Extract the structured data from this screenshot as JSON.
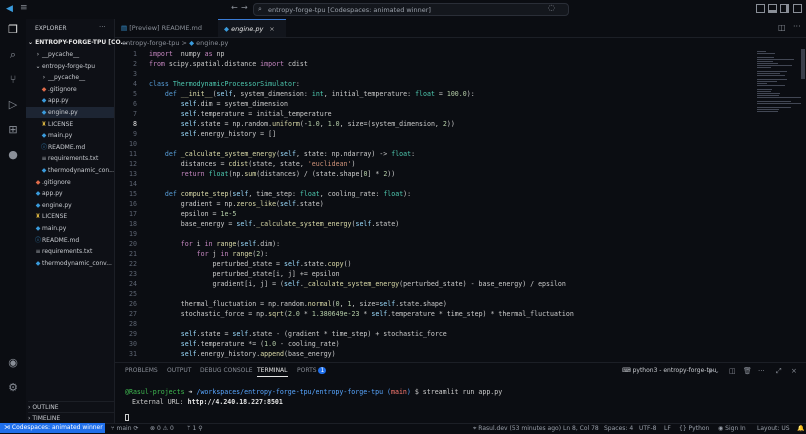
{
  "titlebar": {
    "back": "←",
    "forward": "→",
    "search_text": "entropy-forge-tpu [Codespaces: animated winner]"
  },
  "sidebar": {
    "header": "EXPLORER",
    "root": "ENTROPY-FORGE-TPU [CO...",
    "items": [
      {
        "label": "__pycache__",
        "depth": 1,
        "kind": "folder",
        "open": false
      },
      {
        "label": "entropy-forge-tpu",
        "depth": 1,
        "kind": "folder",
        "open": true
      },
      {
        "label": "__pycache__",
        "depth": 2,
        "kind": "folder",
        "open": false
      },
      {
        "label": ".gitignore",
        "depth": 2,
        "kind": "git"
      },
      {
        "label": "app.py",
        "depth": 2,
        "kind": "py"
      },
      {
        "label": "engine.py",
        "depth": 2,
        "kind": "py",
        "selected": true
      },
      {
        "label": "LICENSE",
        "depth": 2,
        "kind": "license"
      },
      {
        "label": "main.py",
        "depth": 2,
        "kind": "py"
      },
      {
        "label": "README.md",
        "depth": 2,
        "kind": "md"
      },
      {
        "label": "requirements.txt",
        "depth": 2,
        "kind": "txt"
      },
      {
        "label": "thermodynamic_con...",
        "depth": 2,
        "kind": "py"
      },
      {
        "label": ".gitignore",
        "depth": 1,
        "kind": "git"
      },
      {
        "label": "app.py",
        "depth": 1,
        "kind": "py"
      },
      {
        "label": "engine.py",
        "depth": 1,
        "kind": "py"
      },
      {
        "label": "LICENSE",
        "depth": 1,
        "kind": "license"
      },
      {
        "label": "main.py",
        "depth": 1,
        "kind": "py"
      },
      {
        "label": "README.md",
        "depth": 1,
        "kind": "md"
      },
      {
        "label": "requirements.txt",
        "depth": 1,
        "kind": "txt"
      },
      {
        "label": "thermodynamic_conv...",
        "depth": 1,
        "kind": "py"
      }
    ],
    "outline": "OUTLINE",
    "timeline": "TIMELINE"
  },
  "tabs": [
    {
      "label": "[Preview] README.md",
      "active": false
    },
    {
      "label": "engine.py",
      "active": true
    }
  ],
  "breadcrumb": {
    "folder": "entropy-forge-tpu",
    "sep": ">",
    "file": "engine.py"
  },
  "code_lines": [
    {
      "n": "1",
      "segs": [
        [
          "kw",
          "import"
        ],
        [
          "",
          "  numpy "
        ],
        [
          "kw",
          "as"
        ],
        [
          "",
          " np"
        ]
      ]
    },
    {
      "n": "2",
      "segs": [
        [
          "kw",
          "from"
        ],
        [
          "",
          " scipy.spatial.distance "
        ],
        [
          "kw",
          "import"
        ],
        [
          "",
          " cdist"
        ]
      ]
    },
    {
      "n": "3",
      "segs": []
    },
    {
      "n": "4",
      "segs": [
        [
          "def",
          "class"
        ],
        [
          "",
          " "
        ],
        [
          "cls",
          "ThermodynamicProcessorSimulator"
        ],
        [
          "",
          ":"
        ]
      ]
    },
    {
      "n": "5",
      "segs": [
        [
          "",
          "    "
        ],
        [
          "def",
          "def"
        ],
        [
          "",
          " "
        ],
        [
          "fn",
          "__init__"
        ],
        [
          "",
          "("
        ],
        [
          "self",
          "self"
        ],
        [
          "",
          ", system_dimension: "
        ],
        [
          "cls",
          "int"
        ],
        [
          "",
          ", initial_temperature: "
        ],
        [
          "cls",
          "float"
        ],
        [
          "",
          " = "
        ],
        [
          "num",
          "100.0"
        ],
        [
          "",
          "):"
        ]
      ]
    },
    {
      "n": "6",
      "segs": [
        [
          "",
          "        "
        ],
        [
          "self",
          "self"
        ],
        [
          "",
          ".dim = system_dimension"
        ]
      ]
    },
    {
      "n": "7",
      "segs": [
        [
          "",
          "        "
        ],
        [
          "self",
          "self"
        ],
        [
          "",
          ".temperature = initial_temperature"
        ]
      ]
    },
    {
      "n": "8",
      "segs": [
        [
          "",
          "        "
        ],
        [
          "self",
          "self"
        ],
        [
          "",
          ".state = np.random."
        ],
        [
          "fn",
          "uniform"
        ],
        [
          "",
          "(-"
        ],
        [
          "num",
          "1.0"
        ],
        [
          "",
          ", "
        ],
        [
          "num",
          "1.0"
        ],
        [
          "",
          ", size=(system_dimension, "
        ],
        [
          "num",
          "2"
        ],
        [
          "",
          "))"
        ]
      ],
      "cur": true
    },
    {
      "n": "9",
      "segs": [
        [
          "",
          "        "
        ],
        [
          "self",
          "self"
        ],
        [
          "",
          ".energy_history = []"
        ]
      ]
    },
    {
      "n": "10",
      "segs": []
    },
    {
      "n": "11",
      "segs": [
        [
          "",
          "    "
        ],
        [
          "def",
          "def"
        ],
        [
          "",
          " "
        ],
        [
          "fn",
          "_calculate_system_energy"
        ],
        [
          "",
          "("
        ],
        [
          "self",
          "self"
        ],
        [
          "",
          ", state: np.ndarray) -> "
        ],
        [
          "cls",
          "float"
        ],
        [
          "",
          ":"
        ]
      ]
    },
    {
      "n": "12",
      "segs": [
        [
          "",
          "        distances = "
        ],
        [
          "fn",
          "cdist"
        ],
        [
          "",
          "(state, state, "
        ],
        [
          "str",
          "'euclidean'"
        ],
        [
          "",
          ")"
        ]
      ]
    },
    {
      "n": "13",
      "segs": [
        [
          "",
          "        "
        ],
        [
          "kw",
          "return"
        ],
        [
          "",
          " "
        ],
        [
          "cls",
          "float"
        ],
        [
          "",
          "(np."
        ],
        [
          "fn",
          "sum"
        ],
        [
          "",
          "(distances) / (state.shape["
        ],
        [
          "num",
          "0"
        ],
        [
          "",
          "] * "
        ],
        [
          "num",
          "2"
        ],
        [
          "",
          "))"
        ]
      ]
    },
    {
      "n": "14",
      "segs": []
    },
    {
      "n": "15",
      "segs": [
        [
          "",
          "    "
        ],
        [
          "def",
          "def"
        ],
        [
          "",
          " "
        ],
        [
          "fn",
          "compute_step"
        ],
        [
          "",
          "("
        ],
        [
          "self",
          "self"
        ],
        [
          "",
          ", time_step: "
        ],
        [
          "cls",
          "float"
        ],
        [
          "",
          ", cooling_rate: "
        ],
        [
          "cls",
          "float"
        ],
        [
          "",
          "):"
        ]
      ]
    },
    {
      "n": "16",
      "segs": [
        [
          "",
          "        gradient = np."
        ],
        [
          "fn",
          "zeros_like"
        ],
        [
          "",
          "("
        ],
        [
          "self",
          "self"
        ],
        [
          "",
          ".state)"
        ]
      ]
    },
    {
      "n": "17",
      "segs": [
        [
          "",
          "        epsilon = "
        ],
        [
          "num",
          "1e-5"
        ]
      ]
    },
    {
      "n": "18",
      "segs": [
        [
          "",
          "        base_energy = "
        ],
        [
          "self",
          "self"
        ],
        [
          "",
          "."
        ],
        [
          "fn",
          "_calculate_system_energy"
        ],
        [
          "",
          "("
        ],
        [
          "self",
          "self"
        ],
        [
          "",
          ".state)"
        ]
      ]
    },
    {
      "n": "19",
      "segs": []
    },
    {
      "n": "20",
      "segs": [
        [
          "",
          "        "
        ],
        [
          "kw",
          "for"
        ],
        [
          "",
          " i "
        ],
        [
          "kw",
          "in"
        ],
        [
          "",
          " "
        ],
        [
          "fn",
          "range"
        ],
        [
          "",
          "("
        ],
        [
          "self",
          "self"
        ],
        [
          "",
          ".dim):"
        ]
      ]
    },
    {
      "n": "21",
      "segs": [
        [
          "",
          "            "
        ],
        [
          "kw",
          "for"
        ],
        [
          "",
          " j "
        ],
        [
          "kw",
          "in"
        ],
        [
          "",
          " "
        ],
        [
          "fn",
          "range"
        ],
        [
          "",
          "("
        ],
        [
          "num",
          "2"
        ],
        [
          "",
          "):"
        ]
      ]
    },
    {
      "n": "22",
      "segs": [
        [
          "",
          "                perturbed_state = "
        ],
        [
          "self",
          "self"
        ],
        [
          "",
          ".state."
        ],
        [
          "fn",
          "copy"
        ],
        [
          "",
          "()"
        ]
      ]
    },
    {
      "n": "23",
      "segs": [
        [
          "",
          "                perturbed_state[i, j] += epsilon"
        ]
      ]
    },
    {
      "n": "24",
      "segs": [
        [
          "",
          "                gradient[i, j] = ("
        ],
        [
          "self",
          "self"
        ],
        [
          "",
          "."
        ],
        [
          "fn",
          "_calculate_system_energy"
        ],
        [
          "",
          "(perturbed_state) - base_energy) / epsilon"
        ]
      ]
    },
    {
      "n": "25",
      "segs": []
    },
    {
      "n": "26",
      "segs": [
        [
          "",
          "        thermal_fluctuation = np.random."
        ],
        [
          "fn",
          "normal"
        ],
        [
          "",
          "("
        ],
        [
          "num",
          "0"
        ],
        [
          "",
          ", "
        ],
        [
          "num",
          "1"
        ],
        [
          "",
          ", size="
        ],
        [
          "self",
          "self"
        ],
        [
          "",
          ".state.shape)"
        ]
      ]
    },
    {
      "n": "27",
      "segs": [
        [
          "",
          "        stochastic_force = np."
        ],
        [
          "fn",
          "sqrt"
        ],
        [
          "",
          "("
        ],
        [
          "num",
          "2.0"
        ],
        [
          "",
          " * "
        ],
        [
          "num",
          "1.380649e-23"
        ],
        [
          "",
          " * "
        ],
        [
          "self",
          "self"
        ],
        [
          "",
          ".temperature * time_step) * thermal_fluctuation"
        ]
      ]
    },
    {
      "n": "28",
      "segs": []
    },
    {
      "n": "29",
      "segs": [
        [
          "",
          "        "
        ],
        [
          "self",
          "self"
        ],
        [
          "",
          ".state = "
        ],
        [
          "self",
          "self"
        ],
        [
          "",
          ".state - (gradient * time_step) + stochastic_force"
        ]
      ]
    },
    {
      "n": "30",
      "segs": [
        [
          "",
          "        "
        ],
        [
          "self",
          "self"
        ],
        [
          "",
          ".temperature *= ("
        ],
        [
          "num",
          "1.0"
        ],
        [
          "",
          " - cooling_rate)"
        ]
      ]
    },
    {
      "n": "31",
      "segs": [
        [
          "",
          "        "
        ],
        [
          "self",
          "self"
        ],
        [
          "",
          ".energy_history."
        ],
        [
          "fn",
          "append"
        ],
        [
          "",
          "(base_energy)"
        ]
      ]
    }
  ],
  "panel": {
    "tabs": [
      "PROBLEMS",
      "OUTPUT",
      "DEBUG CONSOLE",
      "TERMINAL",
      "PORTS"
    ],
    "active_tab": "TERMINAL",
    "ports_badge": "1",
    "terminal_name": "python3 - entropy-forge-tpu",
    "term_user": "@Rasul-projects",
    "term_arrow": " ➜ ",
    "term_path": "/workspaces/entropy-forge-tpu/entropy-forge-tpu",
    "term_branch_open": " (",
    "term_branch": "main",
    "term_branch_close": ")",
    "term_cmd": " $ streamlit run app.py",
    "url_label": "External URL:",
    "url_value": "http://4.240.18.227:8501"
  },
  "statusbar": {
    "remote": "Codespaces: animated winner",
    "branch": "main",
    "errors": "0",
    "warnings": "0",
    "ports": "1",
    "blame": "Rasul.dev (53 minutes ago)",
    "position": "Ln 8, Col 78",
    "spaces": "Spaces: 4",
    "encoding": "UTF-8",
    "eol": "LF",
    "language": "Python",
    "signin": "Sign In",
    "layout": "Layout: US"
  },
  "colors": {
    "accent": "#1f6feb",
    "active_tab": "#3a7bd5"
  }
}
